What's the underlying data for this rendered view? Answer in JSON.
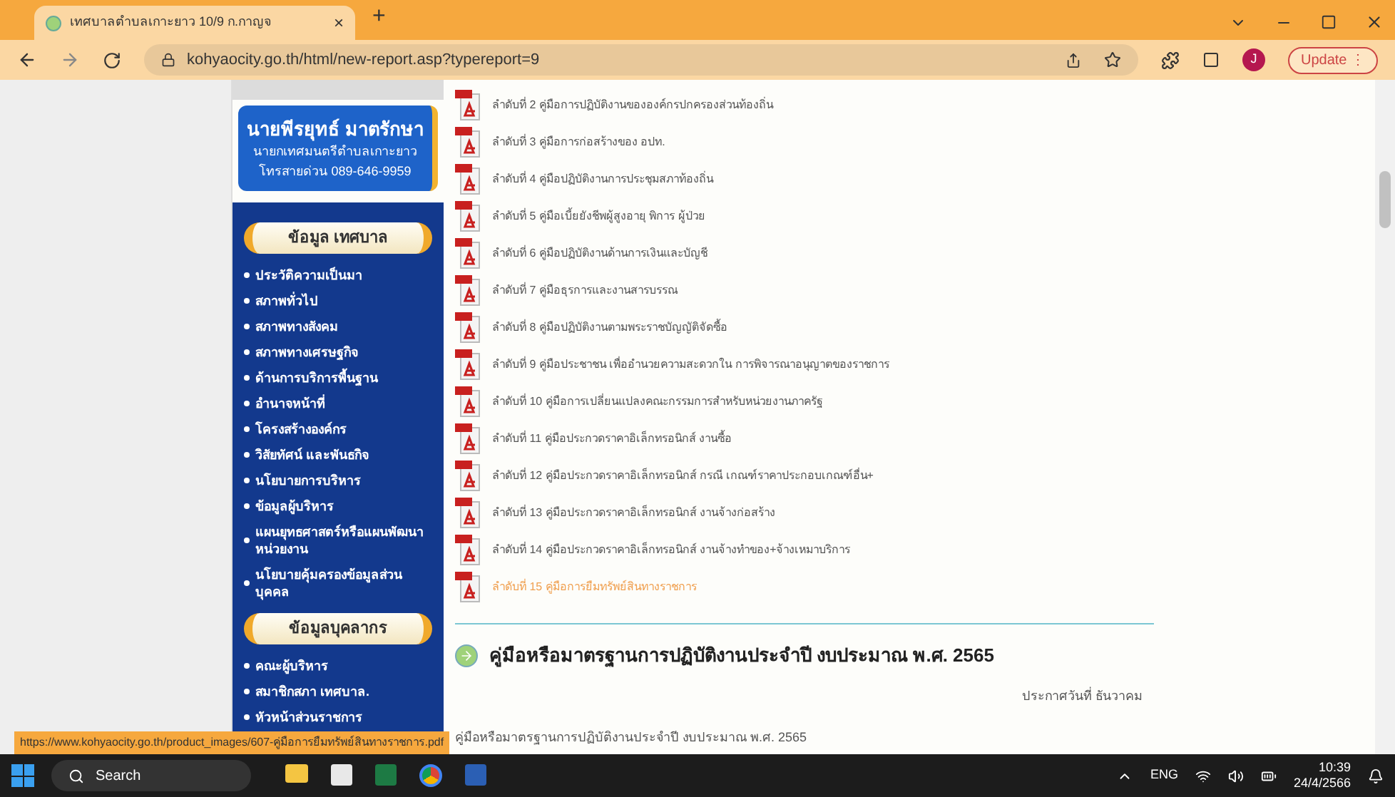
{
  "browser": {
    "tab_title": "เทศบาลตำบลเกาะยาว 10/9 ก.กาญจ",
    "tab_close": "×",
    "new_tab": "+",
    "url": "kohyaocity.go.th/html/new-report.asp?typereport=9",
    "avatar": "J",
    "update_label": "Update",
    "menu_glyph": "⋮"
  },
  "sidebar": {
    "mayor": {
      "name": "นายพีรยุทธ์ มาตรักษา",
      "title": "นายกเทศมนตรีตำบลเกาะยาว",
      "hotline": "โทรสายด่วน 089-646-9959"
    },
    "sections": [
      {
        "heading": "ข้อมูล เทศบาล",
        "items": [
          "ประวัติความเป็นมา",
          "สภาพทั่วไป",
          "สภาพทางสังคม",
          "สภาพทางเศรษฐกิจ",
          "ด้านการบริการพื้นฐาน",
          "อำนาจหน้าที่",
          "โครงสร้างองค์กร",
          "วิสัยทัศน์ และพันธกิจ",
          "นโยบายการบริหาร",
          "ข้อมูลผู้บริหาร",
          "แผนยุทธศาสตร์หรือแผนพัฒนาหน่วยงาน",
          "นโยบายคุ้มครองข้อมูลส่วนบุคคล"
        ]
      },
      {
        "heading": "ข้อมูลบุคลากร",
        "items": [
          "คณะผู้บริหาร",
          "สมาชิกสภา เทศบาล.",
          "หัวหน้าส่วนราชการ"
        ]
      }
    ]
  },
  "documents": [
    {
      "label": "ลำดับที่ 2 คู่มือการปฏิบัติงานขององค์กรปกครองส่วนท้องถิ่น",
      "hovered": false
    },
    {
      "label": "ลำดับที่ 3 คู่มือการก่อสร้างของ อปท.",
      "hovered": false
    },
    {
      "label": "ลำดับที่ 4 คู่มือปฏิบัติงานการประชุมสภาท้องถิ่น",
      "hovered": false
    },
    {
      "label": "ลำดับที่ 5 คู่มือเบี้ยยังชีพผู้สูงอายุ พิการ ผู้ป่วย",
      "hovered": false
    },
    {
      "label": "ลำดับที่ 6 คู่มือปฏิบัติงานด้านการเงินและบัญชี",
      "hovered": false
    },
    {
      "label": "ลำดับที่ 7 คู่มือธุรการและงานสารบรรณ",
      "hovered": false
    },
    {
      "label": "ลำดับที่ 8 คู่มือปฏิบัติงานตามพระราชบัญญัติจัดซื้อ",
      "hovered": false
    },
    {
      "label": "ลำดับที่ 9 คู่มือประชาชน เพื่ออำนวยความสะดวกใน การพิจารณาอนุญาตของราชการ",
      "hovered": false
    },
    {
      "label": "ลำดับที่ 10 คู่มือการเปลี่ยนแปลงคณะกรรมการสำหรับหน่วยงานภาครัฐ",
      "hovered": false
    },
    {
      "label": "ลำดับที่ 11 คู่มือประกวดราคาอิเล็กทรอนิกส์ งานซื้อ",
      "hovered": false
    },
    {
      "label": "ลำดับที่ 12 คู่มือประกวดราคาอิเล็กทรอนิกส์ กรณี เกณฑ์ราคาประกอบเกณฑ์อื่น+",
      "hovered": false
    },
    {
      "label": "ลำดับที่ 13 คู่มือประกวดราคาอิเล็กทรอนิกส์ งานจ้างก่อสร้าง",
      "hovered": false
    },
    {
      "label": "ลำดับที่ 14 คู่มือประกวดราคาอิเล็กทรอนิกส์ งานจ้างทำของ+จ้างเหมาบริการ",
      "hovered": false
    },
    {
      "label": "ลำดับที่ 15 คู่มือการยืมทรัพย์สินทางราชการ",
      "hovered": true
    }
  ],
  "section": {
    "title": "คู่มือหรือมาตรฐานการปฏิบัติงานประจำปี งบประมาณ พ.ศ. 2565",
    "date_label": "ประกาศวันที่ ธันวาคม",
    "description": "คู่มือหรือมาตรฐานการปฏิบัติงานประจำปี งบประมาณ พ.ศ. 2565"
  },
  "status_url": "https://www.kohyaocity.go.th/product_images/607-คู่มือการยืมทรัพย์สินทางราชการ.pdf",
  "taskbar": {
    "search": "Search",
    "language": "ENG",
    "time": "10:39",
    "date": "24/4/2566"
  }
}
